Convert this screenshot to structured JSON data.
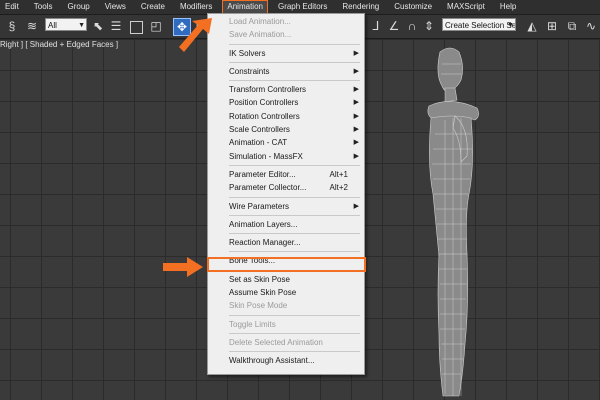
{
  "menubar": {
    "items": [
      "Edit",
      "Tools",
      "Group",
      "Views",
      "Create",
      "Modifiers",
      "Animation",
      "Graph Editors",
      "Rendering",
      "Customize",
      "MAXScript",
      "Help"
    ],
    "active_index": 6
  },
  "toolbar": {
    "filter_value": "All",
    "selection_set_placeholder": "Create Selection Se"
  },
  "viewport": {
    "label": "Right ] [ Shaded + Edged Faces ]"
  },
  "animation_menu": {
    "load_animation": "Load Animation...",
    "save_animation": "Save Animation...",
    "ik_solvers": "IK Solvers",
    "constraints": "Constraints",
    "transform_controllers": "Transform Controllers",
    "position_controllers": "Position Controllers",
    "rotation_controllers": "Rotation Controllers",
    "scale_controllers": "Scale Controllers",
    "animation_cat": "Animation - CAT",
    "simulation_massfx": "Simulation - MassFX",
    "parameter_editor": "Parameter Editor...",
    "parameter_editor_shortcut": "Alt+1",
    "parameter_collector": "Parameter Collector...",
    "parameter_collector_shortcut": "Alt+2",
    "wire_parameters": "Wire Parameters",
    "animation_layers": "Animation Layers...",
    "reaction_manager": "Reaction Manager...",
    "bone_tools": "Bone Tools...",
    "set_as_skin_pose": "Set as Skin Pose",
    "assume_skin_pose": "Assume Skin Pose",
    "skin_pose_mode": "Skin Pose Mode",
    "toggle_limits": "Toggle Limits",
    "delete_selected_animation": "Delete Selected Animation",
    "walkthrough_assistant": "Walkthrough Assistant..."
  },
  "colors": {
    "accent": "#f36f21",
    "menu_background": "#efefef",
    "ui_dark": "#2f2f2f"
  },
  "icons": {
    "submenu_arrow": "chevron-right-icon",
    "callout": "arrow-icon"
  }
}
